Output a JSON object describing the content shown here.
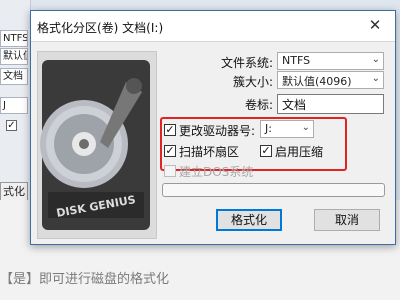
{
  "background": {
    "field_top_partial": "NTFS",
    "field_default_partial": "默认值",
    "field_doc_partial": "文档",
    "field_j_partial": "J",
    "bg_button_partial": "式化",
    "article_line1": "【是】即可进行磁盘的格式化",
    "article_line2": ""
  },
  "dialog": {
    "title": "格式化分区(卷) 文档(I:)",
    "close_glyph": "✕",
    "image_logo": "DISK GENIUS",
    "file_system": {
      "label": "文件系统:",
      "value": "NTFS"
    },
    "cluster_size": {
      "label": "簇大小:",
      "value": "默认值(4096)"
    },
    "volume_label": {
      "label": "卷标:",
      "value": "文档"
    },
    "change_drive_letter": {
      "label": "更改驱动器号:",
      "checked": true,
      "value": "J:"
    },
    "scan_bad_sectors": {
      "label": "扫描坏扇区",
      "checked": true
    },
    "enable_compression": {
      "label": "启用压缩",
      "checked": true
    },
    "create_dos": {
      "label": "建立DOS系统",
      "checked": false,
      "disabled": true
    },
    "progress": 0,
    "format_button": "格式化",
    "cancel_button": "取消",
    "highlight_color": "#e02424",
    "check_mark": "✓",
    "dropdown_arrow": "⌄"
  }
}
